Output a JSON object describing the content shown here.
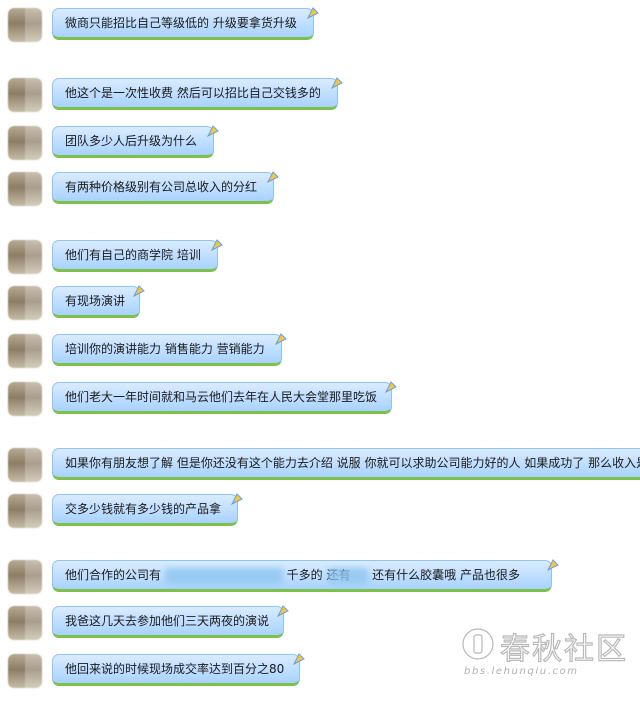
{
  "messages": [
    {
      "text": "微商只能招比自己等级低的 升级要拿货升级"
    },
    {
      "text": "他这个是一次性收费 然后可以招比自己交钱多的"
    },
    {
      "text": "团队多少人后升级为什么"
    },
    {
      "text": "有两种价格级别有公司总收入的分红"
    },
    {
      "text": "他们有自己的商学院 培训"
    },
    {
      "text": "有现场演讲"
    },
    {
      "text": "培训你的演讲能力 销售能力 营销能力"
    },
    {
      "text": "他们老大一年时间就和马云他们去年在人民大会堂那里吃饭"
    },
    {
      "text": "如果你有朋友想了解 但是你还没有这个能力去介绍 说服 你就可以求助公司能力好的人 如果成功了 那么收入是"
    },
    {
      "text": "交多少钱就有多少钱的产品拿"
    },
    {
      "text_a": "他们合作的公司有",
      "text_b": "千多的 还有",
      "text_c": "还有什么胶囊哦 产品也很多"
    },
    {
      "text": "我爸这几天去参加他们三天两夜的演说"
    },
    {
      "text": "他回来说的时候现场成交率达到百分之80"
    }
  ],
  "watermark": {
    "brand": "春秋社区",
    "url": "bbs.lehunqiu.com"
  },
  "colors": {
    "bubble_top": "#d9ecff",
    "bubble_bottom": "#a9d2ff",
    "bubble_border": "#8ec4f2",
    "bubble_shadow": "#7cc24a"
  }
}
